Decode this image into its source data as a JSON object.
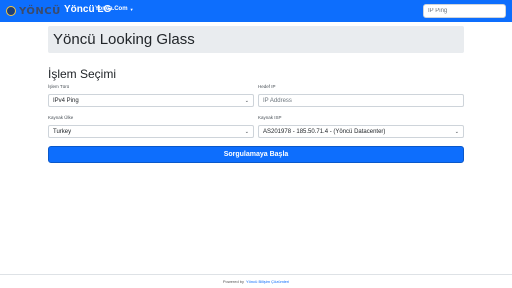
{
  "navbar": {
    "logo_text": "YÖNCÜ",
    "brand": "Yöncü LG",
    "dropdown_label": "Yonca.Com",
    "search_placeholder": "IP Ping"
  },
  "header": {
    "title": "Yöncü Looking Glass"
  },
  "form": {
    "section_title": "İşlem Seçimi",
    "operation_type": {
      "label": "İşlem Türü",
      "value": "IPv4 Ping"
    },
    "target_ip": {
      "label": "Hedef IP",
      "placeholder": "IP Address"
    },
    "source_country": {
      "label": "Kaynak Ülke",
      "value": "Turkey"
    },
    "source_isp": {
      "label": "Kaynak ISP",
      "value": "AS201978 - 185.50.71.4 - (Yöncü Datacenter)"
    },
    "submit_label": "Sorgulamaya Başla"
  },
  "footer": {
    "prefix": "Powered by",
    "link": "Yöncü Bilişim Çözümleri"
  },
  "colors": {
    "primary": "#0d6efd",
    "jumbotron": "#e9ecef",
    "text": "#212529"
  }
}
